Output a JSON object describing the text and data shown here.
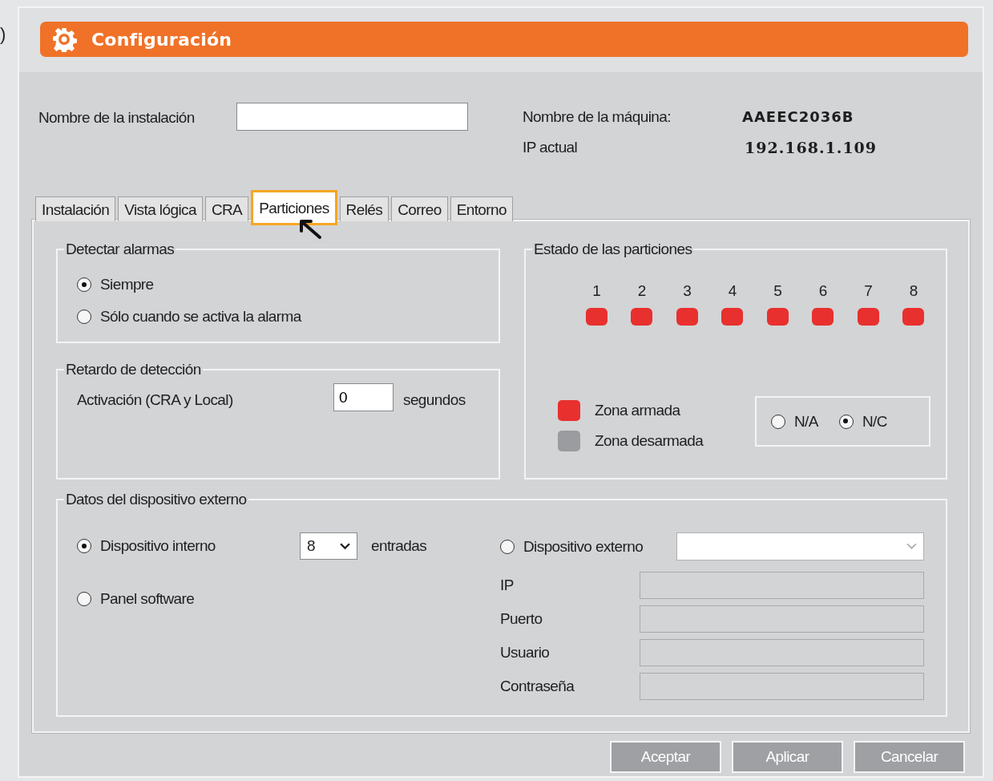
{
  "edge_text": ")",
  "window": {
    "title": "Configuración"
  },
  "installation_name": {
    "label": "Nombre de la instalación"
  },
  "machine": {
    "label": "Nombre de la máquina:",
    "value": "AAEEC2036B"
  },
  "current_ip": {
    "label": "IP actual",
    "value": "192.168.1.109"
  },
  "tabs": [
    {
      "label": "Instalación",
      "selected": false,
      "highlighted": false
    },
    {
      "label": "Vista lógica",
      "selected": false,
      "highlighted": false
    },
    {
      "label": "CRA",
      "selected": false,
      "highlighted": false
    },
    {
      "label": "Particiones",
      "selected": true,
      "highlighted": true
    },
    {
      "label": "Relés",
      "selected": false,
      "highlighted": false
    },
    {
      "label": "Correo",
      "selected": false,
      "highlighted": false
    },
    {
      "label": "Entorno",
      "selected": false,
      "highlighted": false
    }
  ],
  "detect_alarms": {
    "title": "Detectar alarmas",
    "options": [
      {
        "label": "Siempre",
        "selected": true
      },
      {
        "label": "Sólo cuando se activa la alarma",
        "selected": false
      }
    ]
  },
  "detection_delay": {
    "title": "Retardo de detección",
    "label": "Activación (CRA y Local)",
    "value": "0",
    "unit": "segundos"
  },
  "partition_status": {
    "title": "Estado de las particiones",
    "partitions": [
      {
        "label": "1",
        "armed": true
      },
      {
        "label": "2",
        "armed": true
      },
      {
        "label": "3",
        "armed": true
      },
      {
        "label": "4",
        "armed": true
      },
      {
        "label": "5",
        "armed": true
      },
      {
        "label": "6",
        "armed": true
      },
      {
        "label": "7",
        "armed": true
      },
      {
        "label": "8",
        "armed": true
      }
    ],
    "legend": [
      {
        "label": "Zona armada",
        "color": "#e8302e"
      },
      {
        "label": "Zona desarmada",
        "color": "#9a9c9f"
      }
    ],
    "contact_type": [
      {
        "label": "N/A",
        "selected": false
      },
      {
        "label": "N/C",
        "selected": true
      }
    ]
  },
  "external_device": {
    "title": "Datos del dispositivo externo",
    "internal": {
      "label": "Dispositivo interno",
      "selected": true,
      "inputs": "8",
      "unit": "entradas"
    },
    "software": {
      "label": "Panel software",
      "selected": false
    },
    "external": {
      "label": "Dispositivo externo",
      "selected": false
    },
    "fields": [
      {
        "label": "IP",
        "disabled": true
      },
      {
        "label": "Puerto",
        "disabled": true
      },
      {
        "label": "Usuario",
        "disabled": true
      },
      {
        "label": "Contraseña",
        "disabled": true
      }
    ]
  },
  "buttons": [
    {
      "label": "Aceptar"
    },
    {
      "label": "Aplicar"
    },
    {
      "label": "Cancelar"
    }
  ]
}
